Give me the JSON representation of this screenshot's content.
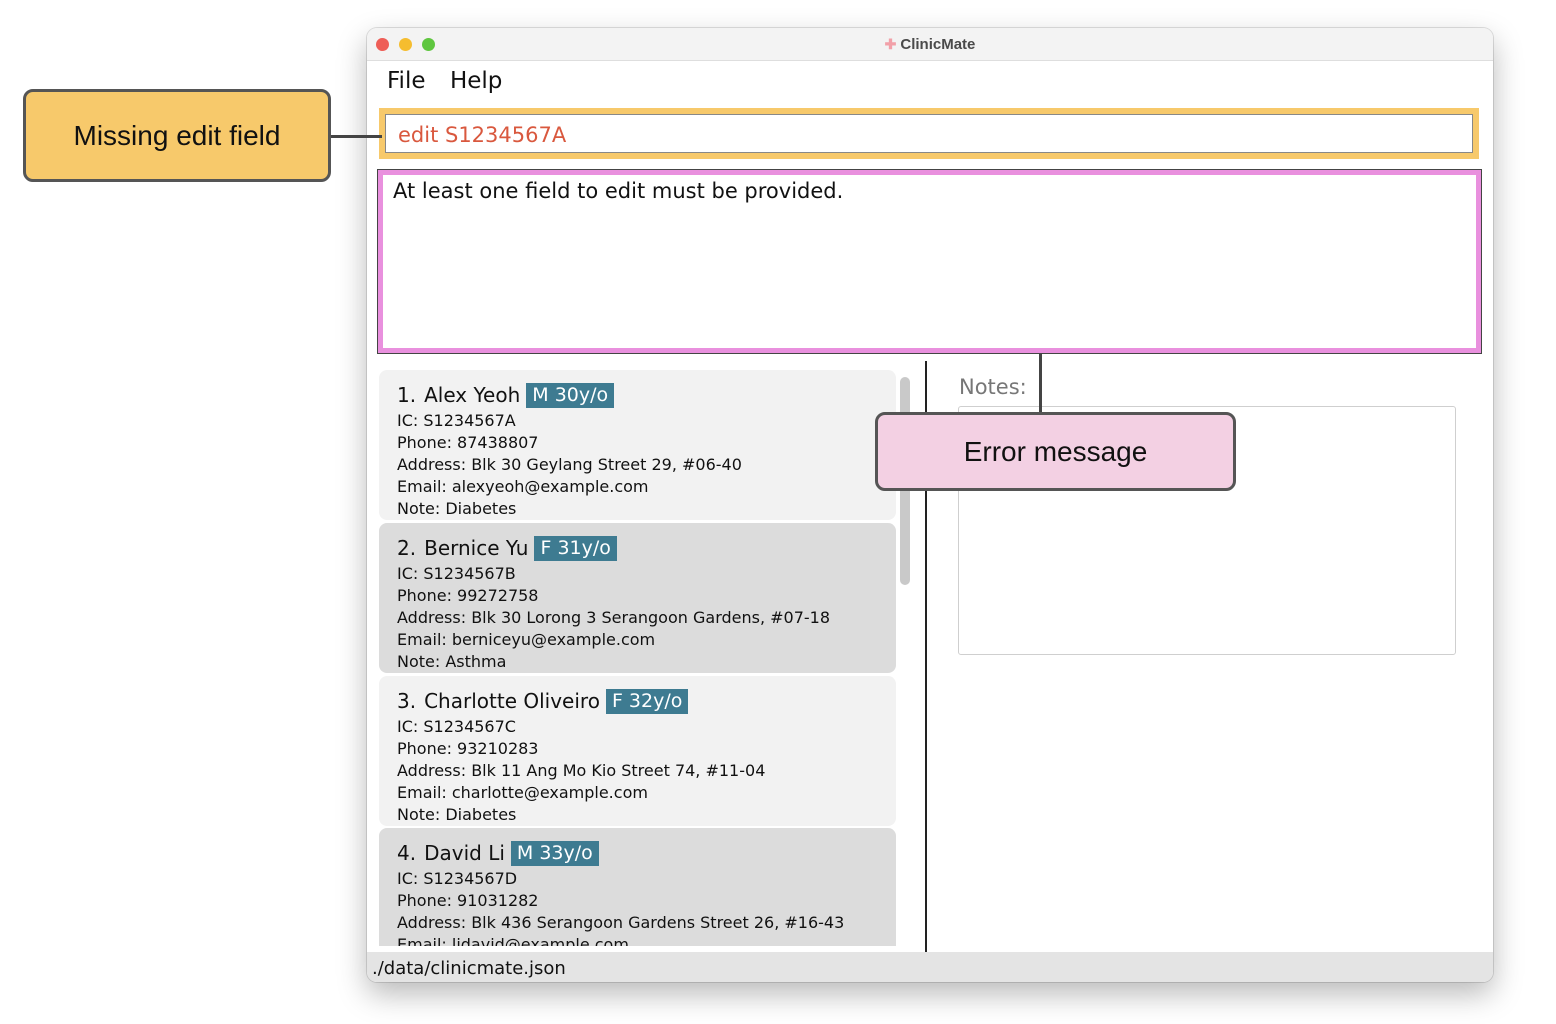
{
  "window": {
    "title": "ClinicMate",
    "icon": "plus-icon"
  },
  "menu": {
    "items": [
      "File",
      "Help"
    ]
  },
  "command": {
    "value": "edit S1234567A"
  },
  "result": {
    "message": "At least one field to edit must be provided."
  },
  "patients": [
    {
      "index": "1.",
      "name": "Alex Yeoh",
      "tag": "M 30y/o",
      "ic": "IC: S1234567A",
      "phone": "Phone: 87438807",
      "address": "Address: Blk 30 Geylang Street 29, #06-40",
      "email": "Email: alexyeoh@example.com",
      "note": "Note: Diabetes"
    },
    {
      "index": "2.",
      "name": "Bernice Yu",
      "tag": "F 31y/o",
      "ic": "IC: S1234567B",
      "phone": "Phone: 99272758",
      "address": "Address: Blk 30 Lorong 3 Serangoon Gardens, #07-18",
      "email": "Email: berniceyu@example.com",
      "note": "Note: Asthma"
    },
    {
      "index": "3.",
      "name": "Charlotte Oliveiro",
      "tag": "F 32y/o",
      "ic": "IC: S1234567C",
      "phone": "Phone: 93210283",
      "address": "Address: Blk 11 Ang Mo Kio Street 74, #11-04",
      "email": "Email: charlotte@example.com",
      "note": "Note: Diabetes"
    },
    {
      "index": "4.",
      "name": "David Li",
      "tag": "M 33y/o",
      "ic": "IC: S1234567D",
      "phone": "Phone: 91031282",
      "address": "Address: Blk 436 Serangoon Gardens Street 26, #16-43",
      "email": "Email: lidavid@example.com",
      "note": ""
    }
  ],
  "notes": {
    "label": "Notes:"
  },
  "status": {
    "path": "./data/clinicmate.json"
  },
  "annotations": {
    "missing_field": "Missing edit field",
    "error_message": "Error message"
  },
  "colors": {
    "command_highlight": "#f7c96b",
    "result_highlight": "#e990de",
    "tag_background": "#3e7b91",
    "command_text": "#d9583e",
    "error_callout": "#f3d0e3"
  }
}
